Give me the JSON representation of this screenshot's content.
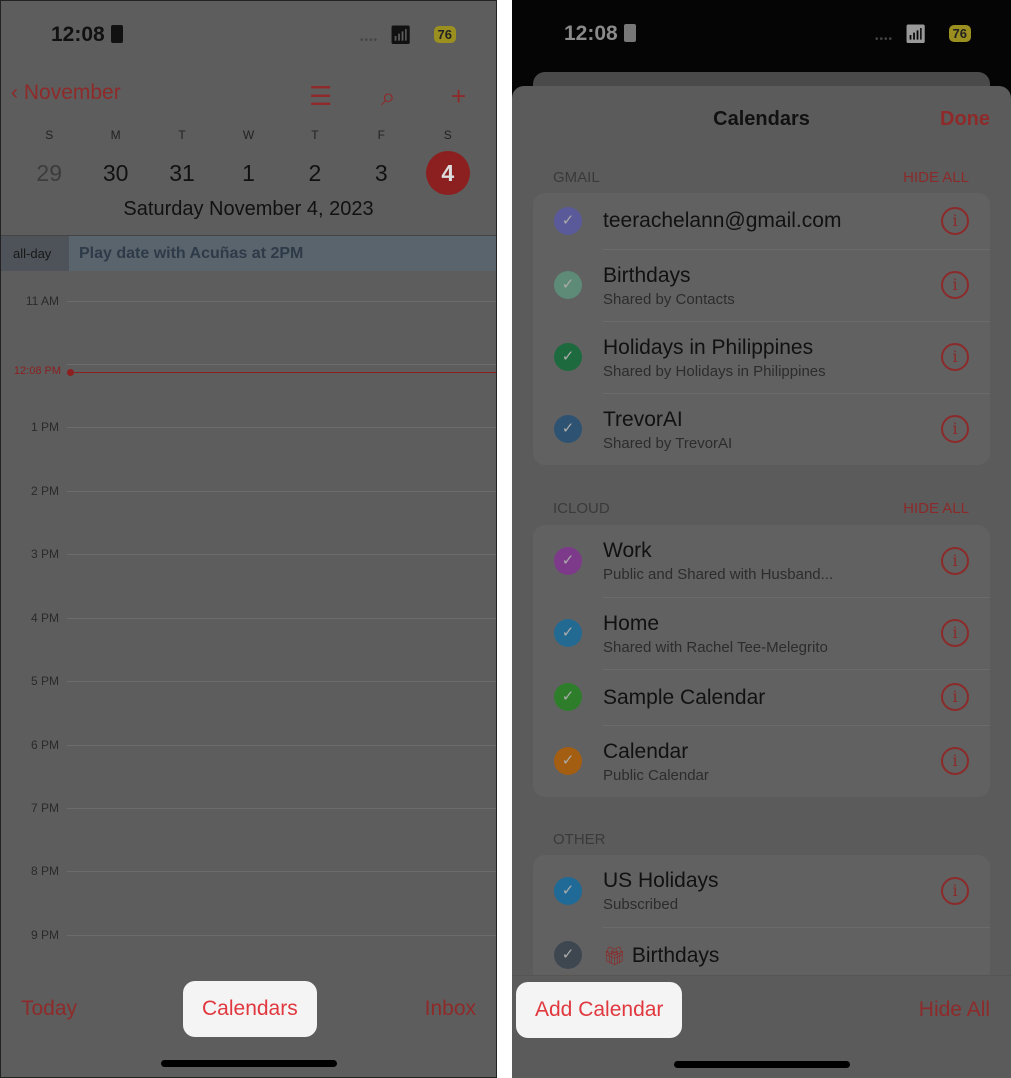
{
  "status": {
    "time": "12:08",
    "battery": "76"
  },
  "left": {
    "nav": {
      "back_label": "November",
      "list_icon": "list-icon",
      "search_icon": "search-icon",
      "add_icon": "plus-icon"
    },
    "weekdays": [
      "S",
      "M",
      "T",
      "W",
      "T",
      "F",
      "S"
    ],
    "dates": [
      "29",
      "30",
      "31",
      "1",
      "2",
      "3",
      "4"
    ],
    "selected_date": "4",
    "date_title": "Saturday  November 4, 2023",
    "allday_label": "all-day",
    "allday_event": "Play date with Acuñas at 2PM",
    "hours": [
      "11 AM",
      "1 PM",
      "2 PM",
      "3 PM",
      "4 PM",
      "5 PM",
      "6 PM",
      "7 PM",
      "8 PM",
      "9 PM"
    ],
    "now_label": "12:08 PM",
    "toolbar": {
      "today": "Today",
      "calendars": "Calendars",
      "inbox": "Inbox"
    }
  },
  "right": {
    "title": "Calendars",
    "done": "Done",
    "sections": [
      {
        "header": "GMAIL",
        "hide_all": "HIDE ALL",
        "items": [
          {
            "name": "teerachelann@gmail.com",
            "sub": "",
            "color": "#5a5a9a"
          },
          {
            "name": "Birthdays",
            "sub": "Shared by Contacts",
            "color": "#5e8a78"
          },
          {
            "name": "Holidays in Philippines",
            "sub": "Shared by Holidays in Philippines",
            "color": "#1d6a3e"
          },
          {
            "name": "TrevorAI",
            "sub": "Shared by TrevorAI",
            "color": "#2e5272"
          }
        ]
      },
      {
        "header": "ICLOUD",
        "hide_all": "HIDE ALL",
        "items": [
          {
            "name": "Work",
            "sub": "Public and Shared with Husband...",
            "color": "#7e3a8a"
          },
          {
            "name": "Home",
            "sub": "Shared with Rachel Tee-Melegrito",
            "color": "#236a92"
          },
          {
            "name": "Sample Calendar",
            "sub": "",
            "color": "#2e7d2a"
          },
          {
            "name": "Calendar",
            "sub": "Public Calendar",
            "color": "#a35e12"
          }
        ]
      },
      {
        "header": "OTHER",
        "hide_all": "",
        "items": [
          {
            "name": "US Holidays",
            "sub": "Subscribed",
            "color": "#1f6a96"
          },
          {
            "name": "Birthdays",
            "sub": "",
            "color": "#3e4650",
            "gift": true,
            "no_info": true
          }
        ]
      }
    ],
    "toolbar": {
      "add_calendar": "Add Calendar",
      "hide_all": "Hide All"
    }
  }
}
